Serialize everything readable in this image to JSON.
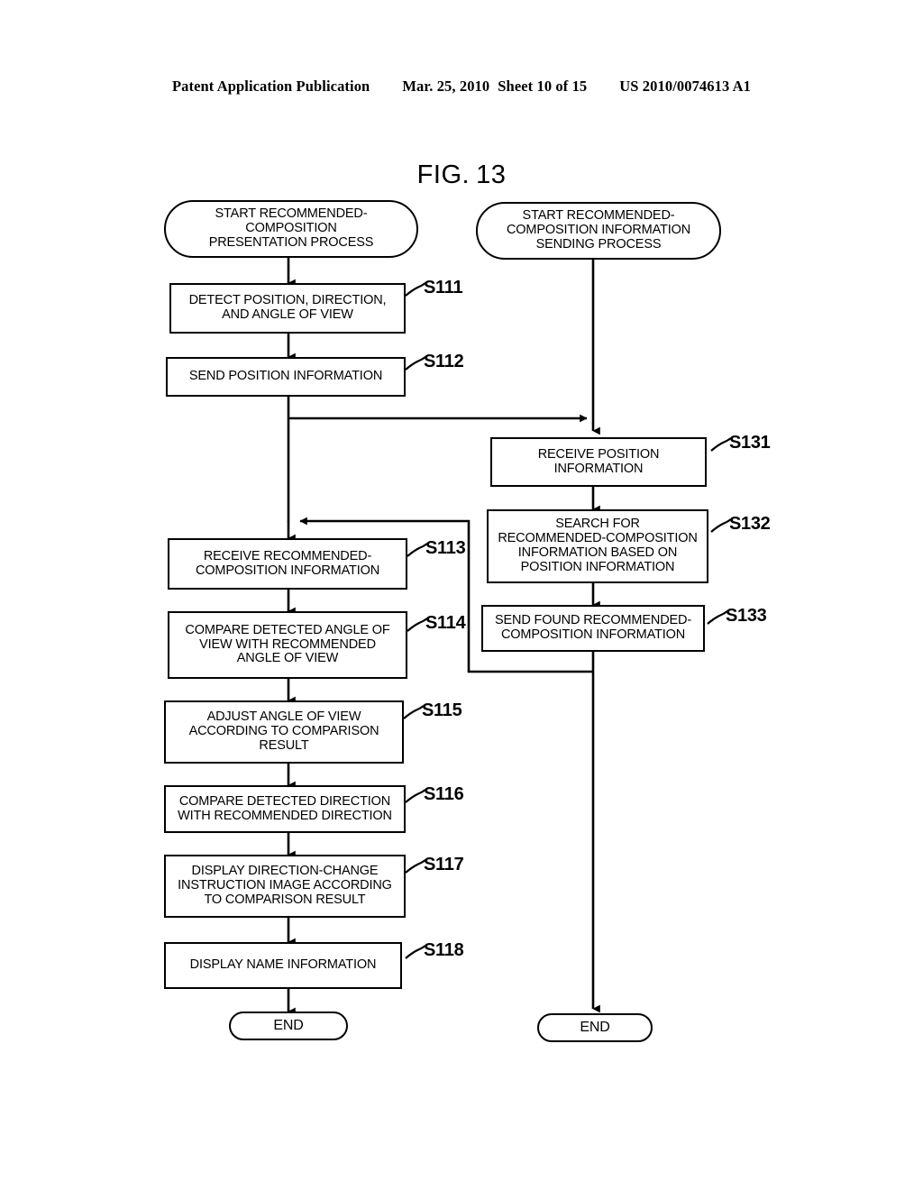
{
  "header": {
    "publication": "Patent Application Publication",
    "date": "Mar. 25, 2010",
    "sheet": "Sheet 10 of 15",
    "number": "US 2010/0074613 A1"
  },
  "figure": {
    "label": "FIG.",
    "number": "13"
  },
  "diagram": {
    "type": "flowchart",
    "lanes": [
      {
        "id": "left-lane",
        "name": "recommended-composition-presentation-process"
      },
      {
        "id": "right-lane",
        "name": "recommended-composition-information-sending-process"
      }
    ],
    "nodes": [
      {
        "id": "start-left",
        "shape": "terminal",
        "lane": "left-lane",
        "text": "START RECOMMENDED-\nCOMPOSITION\nPRESENTATION PROCESS",
        "step": ""
      },
      {
        "id": "s111",
        "shape": "process",
        "lane": "left-lane",
        "text": "DETECT POSITION, DIRECTION,\nAND ANGLE OF VIEW",
        "step": "S111"
      },
      {
        "id": "s112",
        "shape": "process",
        "lane": "left-lane",
        "text": "SEND POSITION INFORMATION",
        "step": "S112"
      },
      {
        "id": "s113",
        "shape": "process",
        "lane": "left-lane",
        "text": "RECEIVE RECOMMENDED-\nCOMPOSITION INFORMATION",
        "step": "S113"
      },
      {
        "id": "s114",
        "shape": "process",
        "lane": "left-lane",
        "text": "COMPARE DETECTED ANGLE OF\nVIEW WITH RECOMMENDED\nANGLE OF VIEW",
        "step": "S114"
      },
      {
        "id": "s115",
        "shape": "process",
        "lane": "left-lane",
        "text": "ADJUST ANGLE OF VIEW\nACCORDING TO COMPARISON\nRESULT",
        "step": "S115"
      },
      {
        "id": "s116",
        "shape": "process",
        "lane": "left-lane",
        "text": "COMPARE DETECTED DIRECTION\nWITH RECOMMENDED DIRECTION",
        "step": "S116"
      },
      {
        "id": "s117",
        "shape": "process",
        "lane": "left-lane",
        "text": "DISPLAY DIRECTION-CHANGE\nINSTRUCTION IMAGE ACCORDING\nTO COMPARISON RESULT",
        "step": "S117"
      },
      {
        "id": "s118",
        "shape": "process",
        "lane": "left-lane",
        "text": "DISPLAY NAME INFORMATION",
        "step": "S118"
      },
      {
        "id": "end-left",
        "shape": "terminal",
        "lane": "left-lane",
        "text": "END",
        "step": ""
      },
      {
        "id": "start-right",
        "shape": "terminal",
        "lane": "right-lane",
        "text": "START RECOMMENDED-\nCOMPOSITION INFORMATION\nSENDING PROCESS",
        "step": ""
      },
      {
        "id": "s131",
        "shape": "process",
        "lane": "right-lane",
        "text": "RECEIVE POSITION\nINFORMATION",
        "step": "S131"
      },
      {
        "id": "s132",
        "shape": "process",
        "lane": "right-lane",
        "text": "SEARCH FOR\nRECOMMENDED-COMPOSITION\nINFORMATION BASED ON\nPOSITION INFORMATION",
        "step": "S132"
      },
      {
        "id": "s133",
        "shape": "process",
        "lane": "right-lane",
        "text": "SEND FOUND RECOMMENDED-\nCOMPOSITION INFORMATION",
        "step": "S133"
      },
      {
        "id": "end-right",
        "shape": "terminal",
        "lane": "right-lane",
        "text": "END",
        "step": ""
      }
    ],
    "edges": [
      {
        "from": "start-left",
        "to": "s111"
      },
      {
        "from": "s111",
        "to": "s112"
      },
      {
        "from": "s112",
        "to": "s131"
      },
      {
        "from": "s112",
        "to": "s113"
      },
      {
        "from": "start-right",
        "to": "s131"
      },
      {
        "from": "s131",
        "to": "s132"
      },
      {
        "from": "s132",
        "to": "s133"
      },
      {
        "from": "s133",
        "to": "s113"
      },
      {
        "from": "s133",
        "to": "end-right"
      },
      {
        "from": "s113",
        "to": "s114"
      },
      {
        "from": "s114",
        "to": "s115"
      },
      {
        "from": "s115",
        "to": "s116"
      },
      {
        "from": "s116",
        "to": "s117"
      },
      {
        "from": "s117",
        "to": "s118"
      },
      {
        "from": "s118",
        "to": "end-left"
      }
    ]
  }
}
